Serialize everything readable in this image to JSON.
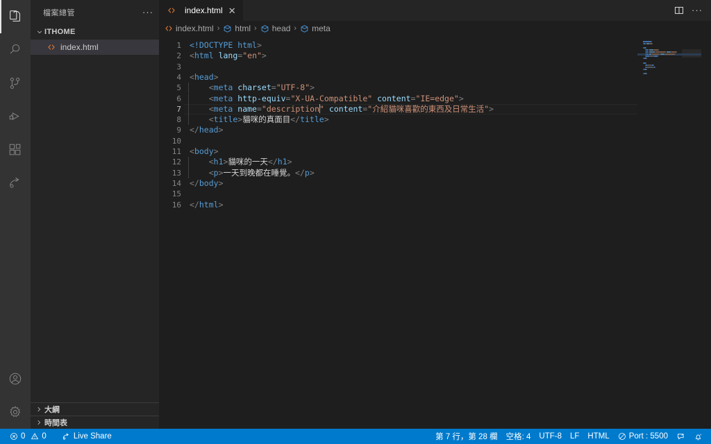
{
  "activitybar": {
    "top_items": [
      {
        "name": "explorer",
        "icon": "files-icon",
        "active": true
      },
      {
        "name": "search",
        "icon": "search-icon",
        "active": false
      },
      {
        "name": "source-control",
        "icon": "source-control-icon",
        "active": false
      },
      {
        "name": "run-debug",
        "icon": "run-and-debug-icon",
        "active": false
      },
      {
        "name": "extensions",
        "icon": "extensions-icon",
        "active": false
      },
      {
        "name": "live-share",
        "icon": "live-share-icon",
        "active": false
      }
    ],
    "bottom_items": [
      {
        "name": "accounts",
        "icon": "account-icon"
      },
      {
        "name": "settings",
        "icon": "gear-icon"
      }
    ]
  },
  "sidebar": {
    "title": "檔案總管",
    "more_actions": "···",
    "folder": {
      "label": "ITHOME",
      "expanded": true
    },
    "files": [
      {
        "label": "index.html",
        "icon": "html-file-icon",
        "selected": true
      }
    ],
    "panels": [
      {
        "label": "大綱",
        "expanded": false
      },
      {
        "label": "時間表",
        "expanded": false
      }
    ]
  },
  "editor": {
    "tabs": [
      {
        "label": "index.html",
        "icon": "html-file-icon",
        "active": true,
        "close": "✕"
      }
    ],
    "actions": [
      {
        "name": "split-editor",
        "icon": "split-editor-icon"
      },
      {
        "name": "more-actions",
        "icon": "ellipsis-icon",
        "glyph": "···"
      }
    ],
    "breadcrumb": [
      {
        "label": "index.html",
        "icon": "html-file-icon"
      },
      {
        "label": "html",
        "icon": "symbol-field-icon"
      },
      {
        "label": "head",
        "icon": "symbol-field-icon"
      },
      {
        "label": "meta",
        "icon": "symbol-field-icon"
      }
    ],
    "breadcrumb_separator": "›",
    "active_line": 7,
    "lines": [
      {
        "n": "1",
        "indent": 0,
        "tokens": [
          {
            "c": "t-doctype",
            "t": "<!DOCTYPE "
          },
          {
            "c": "t-doctype",
            "t": "html"
          },
          {
            "c": "t-punct",
            "t": ">"
          }
        ]
      },
      {
        "n": "2",
        "indent": 0,
        "tokens": [
          {
            "c": "t-punct",
            "t": "<"
          },
          {
            "c": "t-tag",
            "t": "html"
          },
          {
            "c": "t-txt",
            "t": " "
          },
          {
            "c": "t-attr",
            "t": "lang"
          },
          {
            "c": "t-punct",
            "t": "="
          },
          {
            "c": "t-str",
            "t": "\"en\""
          },
          {
            "c": "t-punct",
            "t": ">"
          }
        ]
      },
      {
        "n": "3",
        "indent": 0,
        "tokens": []
      },
      {
        "n": "4",
        "indent": 0,
        "tokens": [
          {
            "c": "t-punct",
            "t": "<"
          },
          {
            "c": "t-tag",
            "t": "head"
          },
          {
            "c": "t-punct",
            "t": ">"
          }
        ]
      },
      {
        "n": "5",
        "indent": 1,
        "tokens": [
          {
            "c": "t-txt",
            "t": "    "
          },
          {
            "c": "t-punct",
            "t": "<"
          },
          {
            "c": "t-tag",
            "t": "meta"
          },
          {
            "c": "t-txt",
            "t": " "
          },
          {
            "c": "t-attr",
            "t": "charset"
          },
          {
            "c": "t-punct",
            "t": "="
          },
          {
            "c": "t-str",
            "t": "\"UTF-8\""
          },
          {
            "c": "t-punct",
            "t": ">"
          }
        ]
      },
      {
        "n": "6",
        "indent": 1,
        "tokens": [
          {
            "c": "t-txt",
            "t": "    "
          },
          {
            "c": "t-punct",
            "t": "<"
          },
          {
            "c": "t-tag",
            "t": "meta"
          },
          {
            "c": "t-txt",
            "t": " "
          },
          {
            "c": "t-attr",
            "t": "http-equiv"
          },
          {
            "c": "t-punct",
            "t": "="
          },
          {
            "c": "t-str",
            "t": "\"X-UA-Compatible\""
          },
          {
            "c": "t-txt",
            "t": " "
          },
          {
            "c": "t-attr",
            "t": "content"
          },
          {
            "c": "t-punct",
            "t": "="
          },
          {
            "c": "t-str",
            "t": "\"IE=edge\""
          },
          {
            "c": "t-punct",
            "t": ">"
          }
        ]
      },
      {
        "n": "7",
        "indent": 1,
        "tokens": [
          {
            "c": "t-txt",
            "t": "    "
          },
          {
            "c": "t-punct",
            "t": "<"
          },
          {
            "c": "t-tag",
            "t": "meta"
          },
          {
            "c": "t-txt",
            "t": " "
          },
          {
            "c": "t-attr",
            "t": "name"
          },
          {
            "c": "t-punct",
            "t": "="
          },
          {
            "c": "t-str",
            "t": "\"description"
          },
          {
            "c": "cursor-mark",
            "t": ""
          },
          {
            "c": "t-str",
            "t": "\""
          },
          {
            "c": "t-txt",
            "t": " "
          },
          {
            "c": "t-attr",
            "t": "content"
          },
          {
            "c": "t-punct",
            "t": "="
          },
          {
            "c": "t-str",
            "t": "\"介紹貓咪喜歡的東西及日常生活\""
          },
          {
            "c": "t-punct",
            "t": ">"
          }
        ]
      },
      {
        "n": "8",
        "indent": 1,
        "tokens": [
          {
            "c": "t-txt",
            "t": "    "
          },
          {
            "c": "t-punct",
            "t": "<"
          },
          {
            "c": "t-tag",
            "t": "title"
          },
          {
            "c": "t-punct",
            "t": ">"
          },
          {
            "c": "t-txt",
            "t": "貓咪的真面目"
          },
          {
            "c": "t-punct",
            "t": "</"
          },
          {
            "c": "t-tag",
            "t": "title"
          },
          {
            "c": "t-punct",
            "t": ">"
          }
        ]
      },
      {
        "n": "9",
        "indent": 0,
        "tokens": [
          {
            "c": "t-punct",
            "t": "</"
          },
          {
            "c": "t-tag",
            "t": "head"
          },
          {
            "c": "t-punct",
            "t": ">"
          }
        ]
      },
      {
        "n": "10",
        "indent": 0,
        "tokens": []
      },
      {
        "n": "11",
        "indent": 0,
        "tokens": [
          {
            "c": "t-punct",
            "t": "<"
          },
          {
            "c": "t-tag",
            "t": "body"
          },
          {
            "c": "t-punct",
            "t": ">"
          }
        ]
      },
      {
        "n": "12",
        "indent": 1,
        "tokens": [
          {
            "c": "t-txt",
            "t": "    "
          },
          {
            "c": "t-punct",
            "t": "<"
          },
          {
            "c": "t-tag",
            "t": "h1"
          },
          {
            "c": "t-punct",
            "t": ">"
          },
          {
            "c": "t-txt",
            "t": "貓咪的一天"
          },
          {
            "c": "t-punct",
            "t": "</"
          },
          {
            "c": "t-tag",
            "t": "h1"
          },
          {
            "c": "t-punct",
            "t": ">"
          }
        ]
      },
      {
        "n": "13",
        "indent": 1,
        "tokens": [
          {
            "c": "t-txt",
            "t": "    "
          },
          {
            "c": "t-punct",
            "t": "<"
          },
          {
            "c": "t-tag",
            "t": "p"
          },
          {
            "c": "t-punct",
            "t": ">"
          },
          {
            "c": "t-txt",
            "t": "一天到晚都在睡覺。"
          },
          {
            "c": "t-punct",
            "t": "</"
          },
          {
            "c": "t-tag",
            "t": "p"
          },
          {
            "c": "t-punct",
            "t": ">"
          }
        ]
      },
      {
        "n": "14",
        "indent": 0,
        "tokens": [
          {
            "c": "t-punct",
            "t": "</"
          },
          {
            "c": "t-tag",
            "t": "body"
          },
          {
            "c": "t-punct",
            "t": ">"
          }
        ]
      },
      {
        "n": "15",
        "indent": 0,
        "tokens": []
      },
      {
        "n": "16",
        "indent": 0,
        "tokens": [
          {
            "c": "t-punct",
            "t": "</"
          },
          {
            "c": "t-tag",
            "t": "html"
          },
          {
            "c": "t-punct",
            "t": ">"
          }
        ]
      }
    ]
  },
  "statusbar": {
    "errors": "0",
    "warnings": "0",
    "live_share": "Live Share",
    "cursor_position": "第 7 行，第 28 欄",
    "indentation": "空格: 4",
    "encoding": "UTF-8",
    "eol": "LF",
    "language": "HTML",
    "port": "Port : 5500",
    "feedback_icon": "feedback-icon",
    "bell_icon": "bell-icon"
  },
  "colors": {
    "accent": "#007acc",
    "activitybar_bg": "#333333",
    "sidebar_bg": "#252526",
    "editor_bg": "#1e1e1e",
    "tag": "#569cd6",
    "attr": "#9cdcfe",
    "string": "#ce9178",
    "html_icon": "#e37933"
  }
}
